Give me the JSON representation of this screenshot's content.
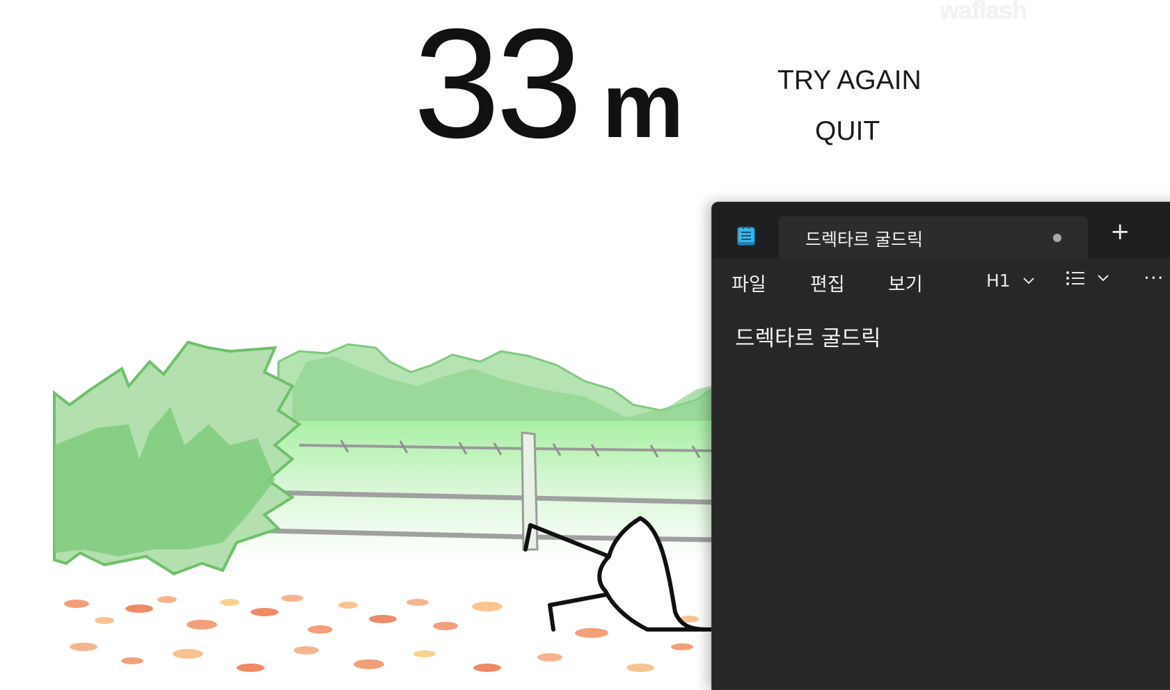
{
  "game": {
    "watermark": "waflash",
    "distance_value": "33",
    "distance_unit": "m",
    "try_again_label": "TRY AGAIN",
    "quit_label": "QUIT"
  },
  "notepad": {
    "tab_title": "드렉타르 굴드릭",
    "new_tab_label": "+",
    "menu": {
      "file": "파일",
      "edit": "편집",
      "view": "보기"
    },
    "heading_label": "H1",
    "more_label": "···",
    "content": "드렉타르 굴드릭"
  },
  "colors": {
    "notepad_bg": "#272727",
    "titlebar_bg": "#1f1f1f",
    "bush_green": "#8fd48e",
    "leaf_orange": "#f2a07a"
  },
  "icons": [
    "notepad-icon",
    "chevron-down-icon",
    "list-icon",
    "more-icon",
    "tab-unsaved-dot-icon",
    "plus-icon"
  ]
}
